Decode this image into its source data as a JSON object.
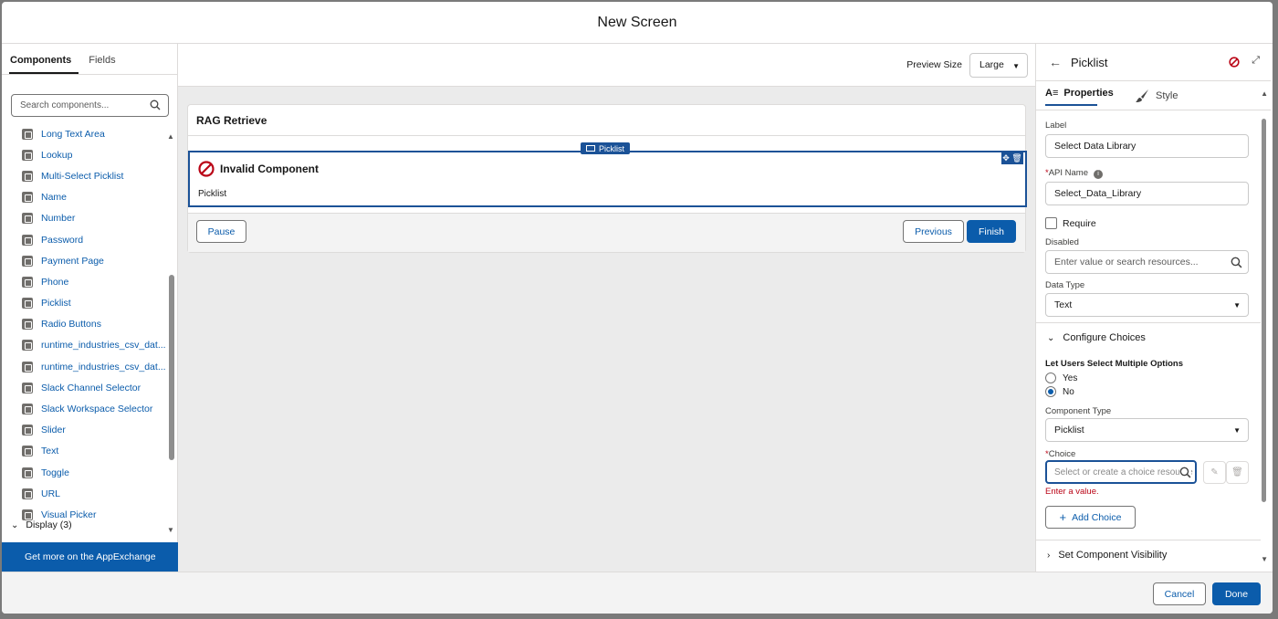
{
  "modal": {
    "title": "New Screen"
  },
  "left": {
    "tabs": [
      {
        "label": "Components"
      },
      {
        "label": "Fields"
      }
    ],
    "search_placeholder": "Search components...",
    "items": [
      {
        "label": "Long Text Area"
      },
      {
        "label": "Lookup"
      },
      {
        "label": "Multi-Select Picklist"
      },
      {
        "label": "Name"
      },
      {
        "label": "Number"
      },
      {
        "label": "Password"
      },
      {
        "label": "Payment Page"
      },
      {
        "label": "Phone"
      },
      {
        "label": "Picklist"
      },
      {
        "label": "Radio Buttons"
      },
      {
        "label": "runtime_industries_csv_dat..."
      },
      {
        "label": "runtime_industries_csv_dat..."
      },
      {
        "label": "Slack Channel Selector"
      },
      {
        "label": "Slack Workspace Selector"
      },
      {
        "label": "Slider"
      },
      {
        "label": "Text"
      },
      {
        "label": "Toggle"
      },
      {
        "label": "URL"
      },
      {
        "label": "Visual Picker"
      }
    ],
    "display_section": "Display (3)",
    "appexchange": "Get more on the AppExchange"
  },
  "center": {
    "preview_label": "Preview Size",
    "preview_value": "Large",
    "screen_title": "RAG Retrieve",
    "component_badge": "Picklist",
    "invalid_title": "Invalid Component",
    "invalid_sub": "Picklist",
    "pause": "Pause",
    "previous": "Previous",
    "finish": "Finish"
  },
  "right": {
    "title": "Picklist",
    "tab_properties": "Properties",
    "tab_style": "Style",
    "label_label": "Label",
    "label_value": "Select Data Library",
    "api_label": "API Name",
    "api_value": "Select_Data_Library",
    "require_label": "Require",
    "disabled_label": "Disabled",
    "disabled_placeholder": "Enter value or search resources...",
    "datatype_label": "Data Type",
    "datatype_value": "Text",
    "configure_choices": "Configure Choices",
    "multi_label": "Let Users Select Multiple Options",
    "opt_yes": "Yes",
    "opt_no": "No",
    "multi_selected": "No",
    "comptype_label": "Component Type",
    "comptype_value": "Picklist",
    "choice_label": "Choice",
    "choice_placeholder": "Select or create a choice resource",
    "choice_error": "Enter a value.",
    "add_choice": "Add Choice",
    "visibility": "Set Component Visibility"
  },
  "footer": {
    "cancel": "Cancel",
    "done": "Done"
  },
  "colors": {
    "brand": "#0b5cab",
    "selection": "#1b5297",
    "error": "#ba0517"
  }
}
